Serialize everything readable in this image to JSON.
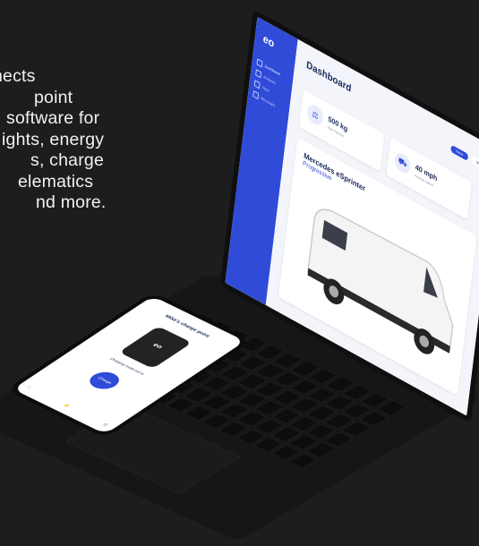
{
  "marketing_copy": [
    "nects",
    "point",
    "software for",
    "ights, energy",
    "s, charge",
    "elematics",
    "nd more."
  ],
  "dashboard": {
    "logo": "eo",
    "title": "Dashboard",
    "nav": [
      "Dashboard",
      "Analytics",
      "Fleet",
      "Messages"
    ],
    "stats": [
      {
        "value": "500 kg",
        "caption": "Total Payload"
      },
      {
        "value": "40 mph",
        "caption": "Average Speed"
      }
    ],
    "toggle": [
      "Today",
      "Week"
    ],
    "vehicle": {
      "name": "Mercedes eSprinter",
      "subtitle": "Progressive"
    }
  },
  "phone": {
    "title": "Mike's charge point",
    "logo": "eo",
    "status": "Charging mode set to",
    "button": "Charge"
  },
  "colors": {
    "accent": "#2f4bd8",
    "background": "#1d1d1d"
  }
}
